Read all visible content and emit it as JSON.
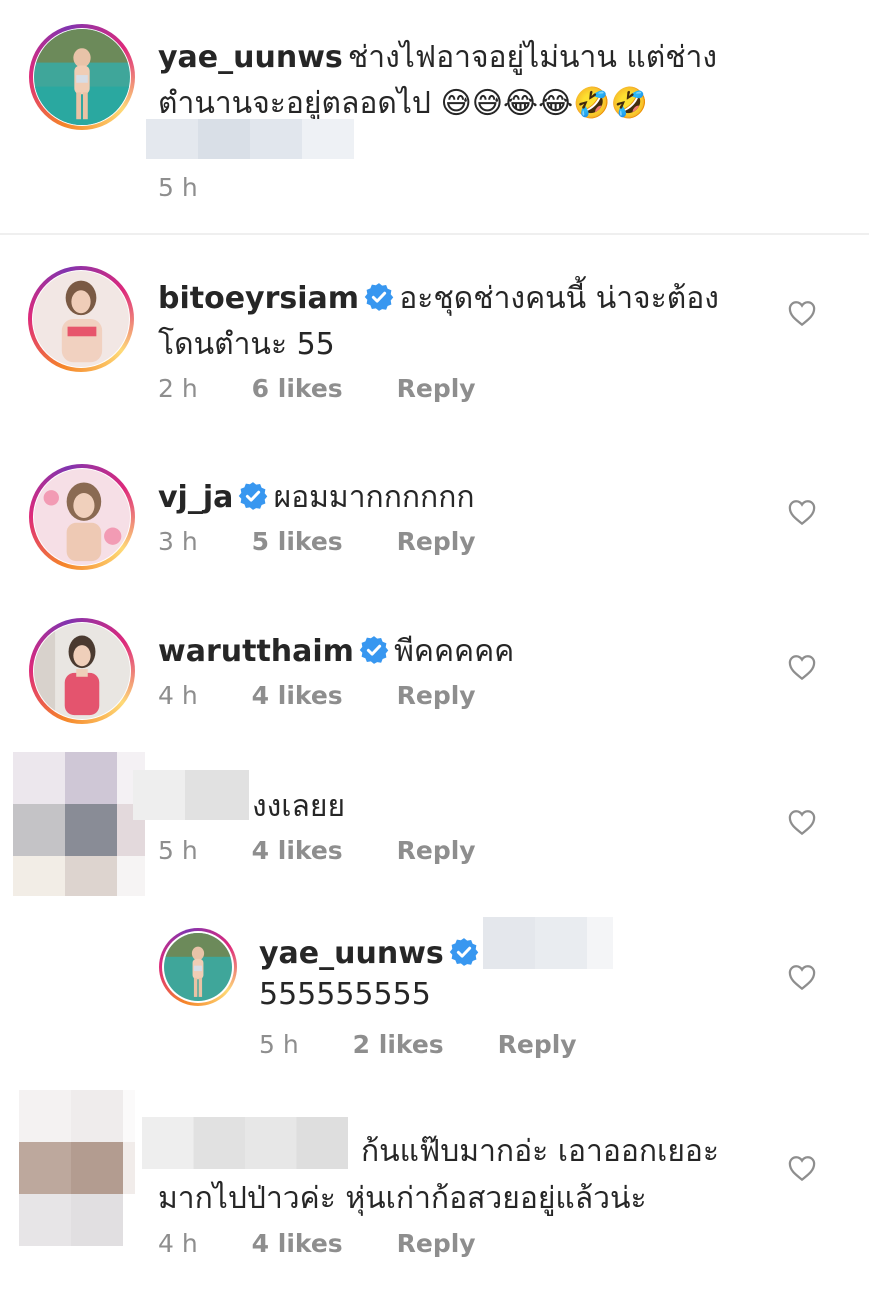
{
  "comments": [
    {
      "username": "yae_uunws",
      "text_line1": "ช่างไฟอาจอยู่ไม่นาน แต่ช่าง",
      "text_line2": "ตำนานจะอยู่ตลอดไป 😅😅😂😂🤣🤣",
      "time": "5 h",
      "verified": false
    },
    {
      "username": "bitoeyrsiam",
      "text_line1": "อะชุดช่างคนนี้ น่าจะต้อง",
      "text_line2": "โดนตำนะ 55",
      "time": "2 h",
      "likes": "6 likes",
      "reply": "Reply",
      "verified": true
    },
    {
      "username": "vj_ja",
      "text_line1": "ผอมมากกกกกก",
      "time": "3 h",
      "likes": "5 likes",
      "reply": "Reply",
      "verified": true
    },
    {
      "username": "warutthaim",
      "text_line1": "พีคคคคค",
      "time": "4 h",
      "likes": "4 likes",
      "reply": "Reply",
      "verified": true
    },
    {
      "username": "",
      "text_line1": "งงเลยย",
      "time": "5 h",
      "likes": "4 likes",
      "reply": "Reply",
      "verified": false
    },
    {
      "username": "yae_uunws",
      "text_line1": "555555555",
      "time": "5 h",
      "likes": "2 likes",
      "reply": "Reply",
      "verified": true
    },
    {
      "username": "",
      "text_line1": "ก้นแฟ๊บมากอ่ะ เอาออกเยอะ",
      "text_line2": "มากไปป่าวค่ะ หุ่นเก่าก้อสวยอยู่แล้วน่ะ",
      "time": "4 h",
      "likes": "4 likes",
      "reply": "Reply",
      "verified": false
    }
  ],
  "colors": {
    "verified_blue": "#3897f0",
    "meta_gray": "#8e8e8e",
    "text_dark": "#262626"
  },
  "icons": {
    "verified": "verified-badge-icon",
    "like": "heart-outline-icon"
  }
}
